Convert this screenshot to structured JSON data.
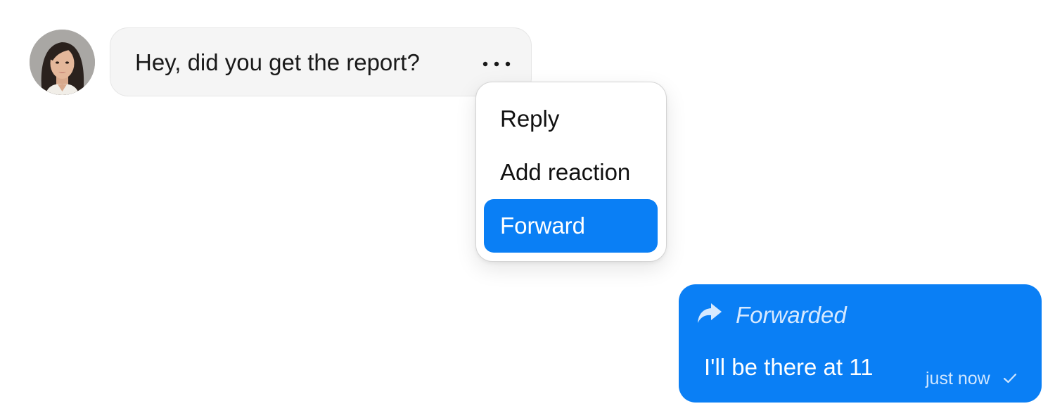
{
  "incoming_message": {
    "text": "Hey, did you get the report?",
    "more_icon": "more-horizontal-icon",
    "avatar": "user-avatar-photo"
  },
  "context_menu": {
    "items": [
      {
        "label": "Reply",
        "highlighted": false
      },
      {
        "label": "Add reaction",
        "highlighted": false
      },
      {
        "label": "Forward",
        "highlighted": true
      }
    ]
  },
  "outgoing_message": {
    "forward_icon": "forward-arrow-icon",
    "forwarded_label": "Forwarded",
    "text": "I'll be there at 11",
    "timestamp": "just now",
    "status_icon": "check-icon"
  },
  "colors": {
    "accent": "#0a7ff5",
    "incoming_bubble": "#f5f5f5",
    "menu_border": "#d4d4d4",
    "text": "#1a1a1a"
  }
}
